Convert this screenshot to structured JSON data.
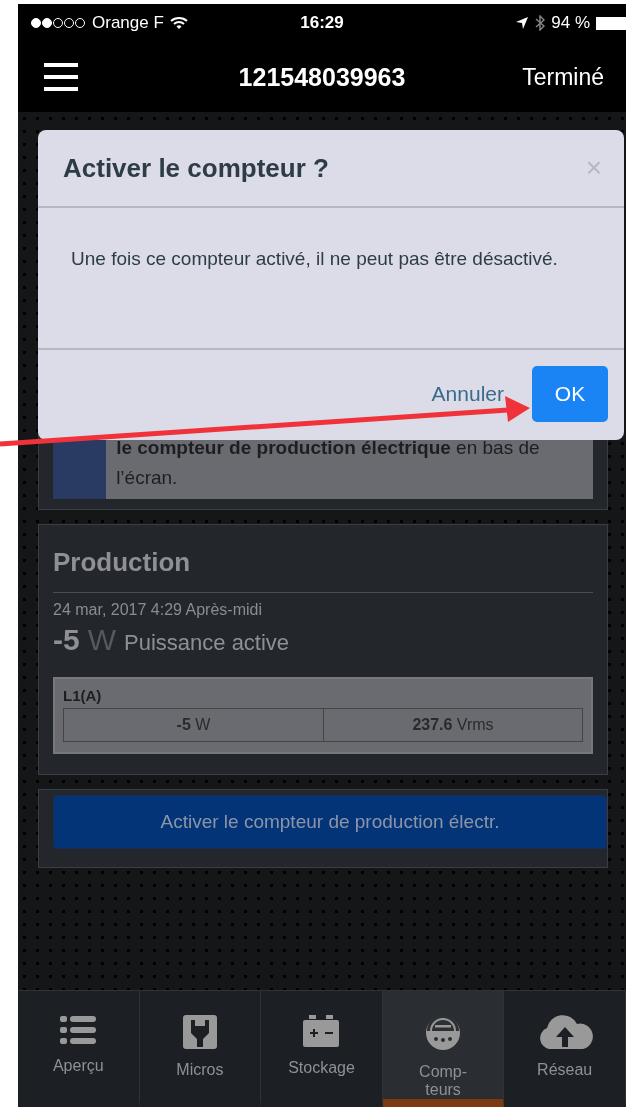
{
  "status_bar": {
    "carrier": "Orange F",
    "time": "16:29",
    "battery": "94 %"
  },
  "nav_bar": {
    "title": "121548039963",
    "done": "Terminé"
  },
  "notice": {
    "text": "**le compteur de production électrique** en bas de l’écran."
  },
  "production": {
    "title": "Production",
    "timestamp": "24 mar, 2017 4:29 Après-midi",
    "value": "-5",
    "unit": "W",
    "label": "Puissance active",
    "phase": {
      "name": "L1(A)",
      "power_value": "-5",
      "power_unit": "W",
      "voltage_value": "237.6",
      "voltage_unit": "Vrms"
    }
  },
  "activate_button": "Activer le compteur de production électr.",
  "dialog": {
    "title": "Activer le compteur ?",
    "close": "×",
    "message": "Une fois ce compteur activé, il ne peut pas être désactivé.",
    "cancel": "Annuler",
    "ok": "OK"
  },
  "tabs": [
    {
      "label": "Aperçu",
      "kind": "list",
      "selected": false
    },
    {
      "label": "Micros",
      "kind": "plug",
      "selected": false
    },
    {
      "label": "Stockage",
      "kind": "battery",
      "selected": false
    },
    {
      "label": "Comp-\nteurs",
      "kind": "meter",
      "selected": true
    },
    {
      "label": "Réseau",
      "kind": "cloud",
      "selected": false
    }
  ]
}
